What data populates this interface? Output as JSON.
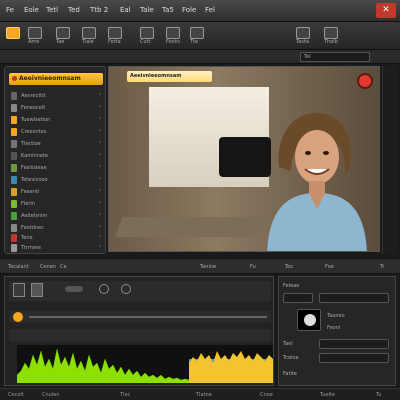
{
  "menubar": {
    "items": [
      "Fe",
      "Eole",
      "Tetl",
      "Ted",
      "Ttb 2",
      "Eal",
      "Tale",
      "Ta5",
      "Fole",
      "Fel"
    ]
  },
  "toolbar": {
    "tools": [
      {
        "label": "",
        "icon": "cursor-icon"
      },
      {
        "label": "Ame",
        "icon": "film-icon"
      },
      {
        "label": "Tae",
        "icon": "trim-icon"
      },
      {
        "label": "Tiale",
        "icon": "monitor-icon"
      },
      {
        "label": "Fetta",
        "icon": "crop-icon"
      },
      {
        "label": "Cutt",
        "icon": "cut-icon"
      },
      {
        "label": "Fecks",
        "icon": "effects-icon"
      },
      {
        "label": "Tte",
        "icon": "audio-icon"
      },
      {
        "label": "Tasta",
        "icon": "grid-icon"
      },
      {
        "label": "Thelb",
        "icon": "export-icon"
      }
    ]
  },
  "secbar": {
    "field": "Tel"
  },
  "left_panel": {
    "header": "Aeeivnieeomnsam",
    "items": [
      "Aenrecttit",
      "Feneocelt",
      "Tuewlsetion",
      "Creoontes",
      "Tlectioe",
      "Kaminnete",
      "Fesliisleae",
      "Tetevicoeo",
      "Feeentl",
      "Flerin",
      "Aeitelsnim",
      "Feotdnec",
      "Tene",
      "Ttrmere"
    ]
  },
  "viewer": {
    "title": "Aeeivnieeomnsam"
  },
  "transport": {
    "items": [
      "Tecalant",
      "Cenen",
      "Ca",
      "Tenine",
      "Fu",
      "Tos",
      "Foe",
      "Tr"
    ]
  },
  "inspector": {
    "field1": "Feleae",
    "field2": "Taaneo",
    "field3": "Feoni",
    "field4": "Tael",
    "field5": "Tceloa",
    "field6": "Fatite"
  },
  "status": {
    "items": [
      "Cecolt",
      "Cnulen",
      "Tlec",
      "Tlatne",
      "Cnoe",
      "Tuelte",
      "Tu"
    ]
  },
  "colors": {
    "accent": "#f5a623",
    "record": "#e03a2f",
    "waveform_green": "#8ee000",
    "waveform_yellow": "#f4c430"
  }
}
